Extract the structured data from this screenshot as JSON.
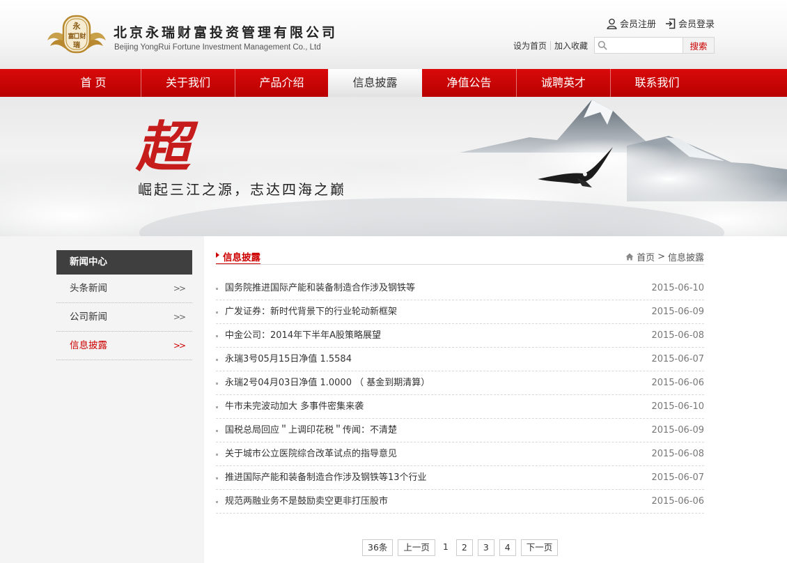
{
  "header": {
    "company_name_cn": "北京永瑞财富投资管理有限公司",
    "company_name_en": "Beijing YongRui Fortune Investment Management Co., Ltd",
    "logo_text": [
      "永",
      "富",
      "财",
      "瑞"
    ],
    "member_register": "会员注册",
    "member_login": "会员登录",
    "set_home": "设为首页",
    "add_favorite": "加入收藏",
    "search_placeholder": "",
    "search_button": "搜索"
  },
  "nav": {
    "items": [
      "首 页",
      "关于我们",
      "产品介绍",
      "信息披露",
      "净值公告",
      "诚聘英才",
      "联系我们"
    ],
    "active_index": 3
  },
  "banner": {
    "character": "超",
    "slogan": "崛起三江之源，志达四海之巅"
  },
  "sidebar": {
    "title": "新闻中心",
    "items": [
      "头条新闻",
      "公司新闻",
      "信息披露"
    ],
    "active_index": 2,
    "arrow": ">>"
  },
  "main": {
    "section_title": "信息披露",
    "breadcrumb": {
      "home": "首页",
      "separator": ">",
      "current": "信息披露"
    },
    "news": [
      {
        "title": "国务院推进国际产能和装备制造合作涉及钢铁等",
        "date": "2015-06-10"
      },
      {
        "title": "广发证券：新时代背景下的行业轮动新框架",
        "date": "2015-06-09"
      },
      {
        "title": "中金公司：2014年下半年A股策略展望",
        "date": "2015-06-08"
      },
      {
        "title": "永瑞3号05月15日净值 1.5584",
        "date": "2015-06-07"
      },
      {
        "title": "永瑞2号04月03日净值 1.0000 （ 基金到期清算）",
        "date": "2015-06-06"
      },
      {
        "title": "牛市未完波动加大 多事件密集来袭",
        "date": "2015-06-10"
      },
      {
        "title": "国税总局回应＂上调印花税＂传闻：不清楚",
        "date": "2015-06-09"
      },
      {
        "title": "关于城市公立医院综合改革试点的指导意见",
        "date": "2015-06-08"
      },
      {
        "title": "推进国际产能和装备制造合作涉及钢铁等13个行业",
        "date": "2015-06-07"
      },
      {
        "title": "规范两融业务不是鼓励卖空更非打压股市",
        "date": "2015-06-06"
      }
    ],
    "pagination": {
      "total": "36条",
      "prev": "上一页",
      "current": "1",
      "pages": [
        "2",
        "3",
        "4"
      ],
      "next": "下一页"
    }
  },
  "colors": {
    "brand_red": "#c00000",
    "nav_red": "#d10606",
    "sidebar_head": "#3f3f3f",
    "logo_gold": "#b8892e"
  }
}
